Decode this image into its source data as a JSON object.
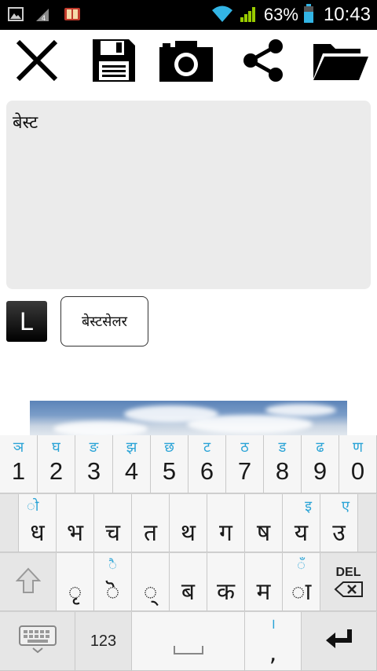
{
  "status_bar": {
    "battery_percent": "63%",
    "time": "10:43",
    "icons": [
      "gallery-icon",
      "signal-4-icon",
      "book-icon",
      "wifi-icon",
      "cell-signal-icon",
      "battery-icon"
    ]
  },
  "toolbar": {
    "buttons": [
      "close-icon",
      "save-icon",
      "camera-icon",
      "share-icon",
      "folder-open-icon"
    ]
  },
  "editor": {
    "text": "बेस्ट"
  },
  "suggestions": {
    "language_badge": "L",
    "items": [
      "बेस्टसेलर"
    ]
  },
  "keyboard": {
    "row1": [
      {
        "main": "1",
        "hint": "ञ"
      },
      {
        "main": "2",
        "hint": "घ"
      },
      {
        "main": "3",
        "hint": "ङ"
      },
      {
        "main": "4",
        "hint": "झ"
      },
      {
        "main": "5",
        "hint": "छ"
      },
      {
        "main": "6",
        "hint": "ट"
      },
      {
        "main": "7",
        "hint": "ठ"
      },
      {
        "main": "8",
        "hint": "ड"
      },
      {
        "main": "9",
        "hint": "ढ"
      },
      {
        "main": "0",
        "hint": "ण"
      }
    ],
    "row2": [
      {
        "main": "ध",
        "hint": "ो"
      },
      {
        "main": "भ",
        "hint": ""
      },
      {
        "main": "च",
        "hint": ""
      },
      {
        "main": "त",
        "hint": ""
      },
      {
        "main": "थ",
        "hint": ""
      },
      {
        "main": "ग",
        "hint": ""
      },
      {
        "main": "ष",
        "hint": ""
      },
      {
        "main": "य",
        "hint": "इ"
      },
      {
        "main": "उ",
        "hint": "ए"
      }
    ],
    "row3": [
      {
        "main": "ृ",
        "hint": ""
      },
      {
        "main": "ॆ",
        "hint": "ै"
      },
      {
        "main": "्",
        "hint": ""
      },
      {
        "main": "ब",
        "hint": ""
      },
      {
        "main": "क",
        "hint": ""
      },
      {
        "main": "म",
        "hint": ""
      },
      {
        "main": "ा",
        "hint": "ँ"
      }
    ],
    "del_label": "DEL",
    "num_label": "123",
    "comma": ",",
    "comma_hint": "।"
  }
}
